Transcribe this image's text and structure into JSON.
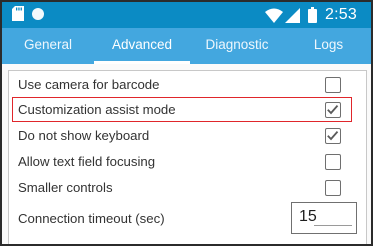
{
  "status_bar": {
    "time": "2:53",
    "left_icons": [
      "sd-card-icon",
      "notification-dot-icon"
    ],
    "right_icons": [
      "wifi-icon",
      "cell-signal-icon",
      "battery-icon"
    ],
    "background_color": "#0b8bc4"
  },
  "tabs": [
    {
      "label": "General",
      "active": false
    },
    {
      "label": "Advanced",
      "active": true
    },
    {
      "label": "Diagnostic",
      "active": false
    },
    {
      "label": "Logs",
      "active": false
    }
  ],
  "tab_bar_color": "#43a7df",
  "settings": [
    {
      "label": "Use camera for barcode",
      "checked": false
    },
    {
      "label": "Customization assist mode",
      "checked": true,
      "highlighted": true
    },
    {
      "label": "Do not show keyboard",
      "checked": true
    },
    {
      "label": "Allow text field focusing",
      "checked": false
    },
    {
      "label": "Smaller controls",
      "checked": false
    }
  ],
  "connection_timeout": {
    "label": "Connection timeout (sec)",
    "value": "15"
  },
  "highlight_color": "#e0262b"
}
